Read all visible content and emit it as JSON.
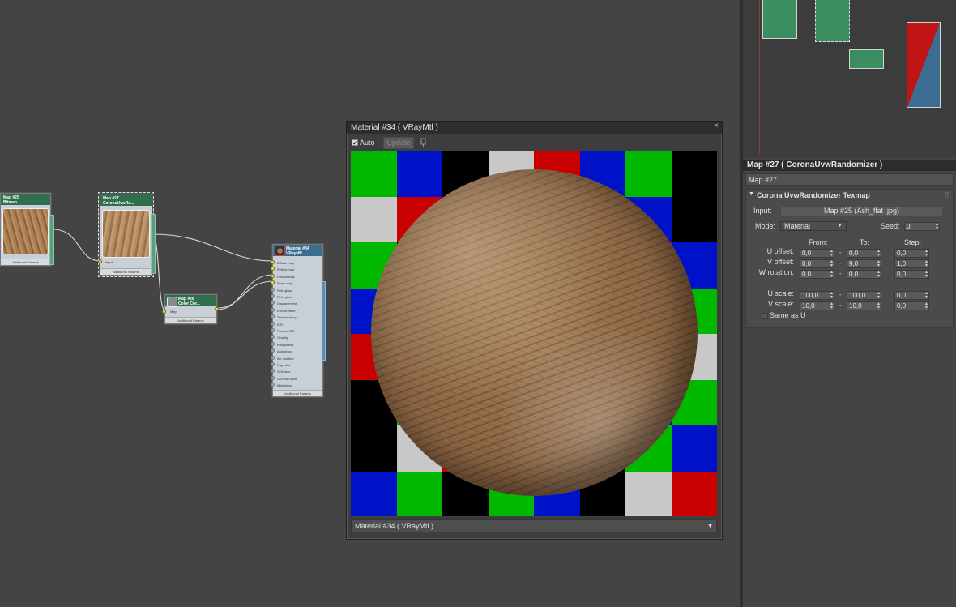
{
  "colors": {
    "node_header_green": "#2f6f4d",
    "node_header_blue": "#3a6d8e",
    "socket_active": "#e4e830"
  },
  "node_editor": {
    "nodes": [
      {
        "id": "n25",
        "title": "Map #25",
        "subtitle": "Bitmap",
        "footer": "Additional Params"
      },
      {
        "id": "n27",
        "title": "Map #27",
        "subtitle": "CoronaUvwRa...",
        "input_label": "Input",
        "footer": "Additional Params"
      },
      {
        "id": "n28",
        "title": "Map #28",
        "subtitle": "Color Cor...",
        "input_label": "Map",
        "footer": "Additional Params"
      },
      {
        "id": "n34",
        "title": "Material #34",
        "subtitle": "VRayMtl",
        "footer": "Additional Params",
        "slots": [
          "Diffuse map",
          "Reflect map",
          "Refract map",
          "Bump map",
          "Refl. gloss",
          "Refr. gloss",
          "Displacement",
          "Environment",
          "Translucency",
          "IOR",
          "Fresnel IOR",
          "Opacity",
          "Roughness",
          "Anisotropy",
          "An. rotation",
          "Fog color",
          "Self-illum",
          "GTR tail falloff",
          "Metalness"
        ]
      }
    ]
  },
  "preview": {
    "title": "Material #34  ( VRayMtl )",
    "auto_label": "Auto",
    "auto_checked": "✔",
    "update_label": "Update",
    "selector_value": "Material #34  ( VRayMtl )",
    "close_icon": "×",
    "grid_colors": [
      "#00b800",
      "#0012c8",
      "#000000",
      "#c8c8c8",
      "#c80000",
      "#0012c8",
      "#00b800",
      "#000000"
    ]
  },
  "params": {
    "title": "Map #27  ( CoronaUvwRandomizer )",
    "name_value": "Map #27",
    "rollout_title": "Corona UvwRandomizer Texmap",
    "input_label": "Input:",
    "input_value": "Map #25 (Ash_flat .jpg)",
    "mode_label": "Mode:",
    "mode_value": "Material",
    "seed_label": "Seed:",
    "seed_value": "0",
    "col_from": "From:",
    "col_to": "To:",
    "col_step": "Step:",
    "rows": [
      {
        "label": "U offset:",
        "from": "0,0",
        "to": "0,0",
        "step": "0,0"
      },
      {
        "label": "V offset:",
        "from": "0,0",
        "to": "9,0",
        "step": "1,0"
      },
      {
        "label": "W rotation:",
        "from": "0,0",
        "to": "0,0",
        "step": "0,0"
      },
      {
        "label": "U scale:",
        "from": "100,0",
        "to": "100,0",
        "step": "0,0"
      },
      {
        "label": "V scale:",
        "from": "10,0",
        "to": "10,0",
        "step": "0,0"
      }
    ],
    "same_as_u_label": "Same as U"
  }
}
